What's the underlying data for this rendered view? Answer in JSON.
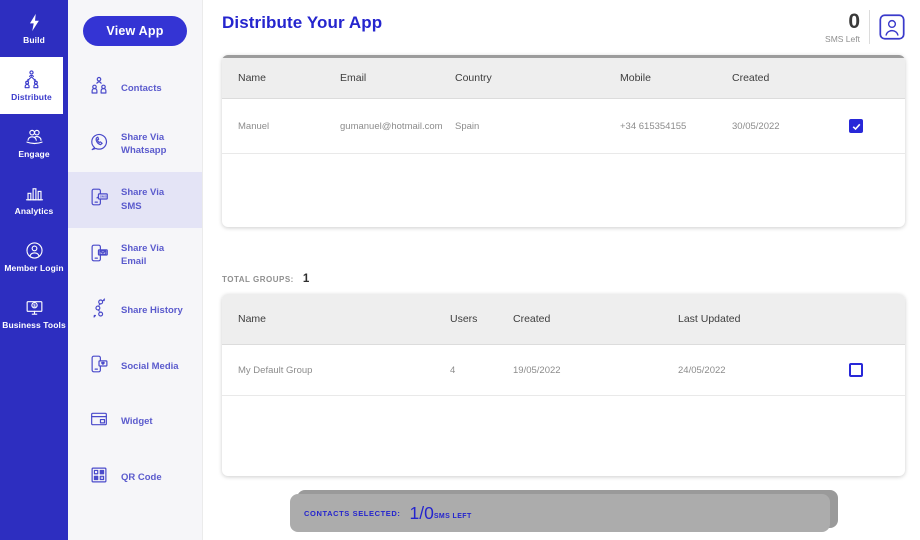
{
  "primary_nav": {
    "items": [
      {
        "label": "Build",
        "icon": "bolt-icon",
        "active": false
      },
      {
        "label": "Distribute",
        "icon": "distribute-icon",
        "active": true
      },
      {
        "label": "Engage",
        "icon": "engage-icon",
        "active": false
      },
      {
        "label": "Analytics",
        "icon": "analytics-icon",
        "active": false
      },
      {
        "label": "Member Login",
        "icon": "member-login-icon",
        "active": false
      },
      {
        "label": "Business Tools",
        "icon": "business-tools-icon",
        "active": false
      }
    ]
  },
  "secondary_nav": {
    "view_app_label": "View App",
    "items": [
      {
        "label": "Contacts",
        "icon": "contacts-icon",
        "active": false
      },
      {
        "label": "Share Via Whatsapp",
        "icon": "whatsapp-icon",
        "active": false
      },
      {
        "label": "Share Via SMS",
        "icon": "sms-phone-icon",
        "active": true
      },
      {
        "label": "Share Via Email",
        "icon": "email-phone-icon",
        "active": false
      },
      {
        "label": "Share History",
        "icon": "share-history-icon",
        "active": false
      },
      {
        "label": "Social Media",
        "icon": "social-media-icon",
        "active": false
      },
      {
        "label": "Widget",
        "icon": "widget-icon",
        "active": false
      },
      {
        "label": "QR Code",
        "icon": "qr-code-icon",
        "active": false
      }
    ]
  },
  "header": {
    "title": "Distribute Your App",
    "sms_count": "0",
    "sms_left_label": "SMS Left"
  },
  "contacts_table": {
    "columns": [
      "Name",
      "Email",
      "Country",
      "Mobile",
      "Created"
    ],
    "rows": [
      {
        "name": "Manuel",
        "email": "gumanuel@hotmail.com",
        "country": "Spain",
        "mobile": "+34 615354155",
        "created": "30/05/2022",
        "selected": true
      }
    ]
  },
  "groups": {
    "total_label": "TOTAL GROUPS:",
    "total": "1",
    "columns": [
      "Name",
      "Users",
      "Created",
      "Last Updated"
    ],
    "rows": [
      {
        "name": "My Default Group",
        "users": "4",
        "created": "19/05/2022",
        "last_updated": "24/05/2022",
        "selected": false
      }
    ]
  },
  "footer": {
    "selected_label": "CONTACTS SELECTED:",
    "count": "1/0",
    "sms_left_label": "SMS LEFT"
  },
  "colors": {
    "sidebar_blue": "#2D2EC0",
    "accent_blue": "#2525CE",
    "button_blue": "#3434D4",
    "active_tile": "#E4E4F6",
    "checkbox_blue": "#2828D8",
    "footer_gray": "#ACACAC"
  }
}
